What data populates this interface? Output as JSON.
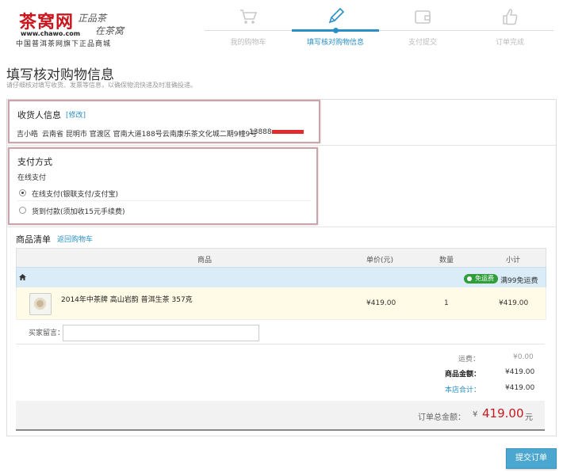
{
  "logo": {
    "brand": "茶窝网",
    "slogan_line1": "正品茶",
    "slogan_line2": "在茶窝",
    "site": "www.chawo.com",
    "tagline": "中国普洱茶网旗下正品商城"
  },
  "steps": [
    {
      "label": "我的购物车",
      "icon": "cart-icon",
      "active": false
    },
    {
      "label": "填写核对购物信息",
      "icon": "pencil-icon",
      "active": true
    },
    {
      "label": "支付提交",
      "icon": "wallet-icon",
      "active": false
    },
    {
      "label": "订单完成",
      "icon": "thumbs-up-icon",
      "active": false
    }
  ],
  "page": {
    "title": "填写核对购物信息",
    "subtitle": "请仔细核对填写收货、发票等信息，以确保物流快递及时准确投递。"
  },
  "receiver": {
    "title": "收货人信息",
    "edit_link": "[修改]",
    "name": "吉小皓",
    "address": "云南省 昆明市 官渡区 官南大道188号云南康乐茶文化城二期9幢9号",
    "phone": "13888"
  },
  "payment": {
    "title": "支付方式",
    "group_label": "在线支付",
    "options": [
      {
        "label": "在线支付(银联支付/支付宝)",
        "selected": true
      },
      {
        "label": "货到付款(须加收15元手续费)",
        "selected": false
      }
    ]
  },
  "goods": {
    "title": "商品清单",
    "back_link": "返回购物车",
    "headers": {
      "product": "商品",
      "price": "单价(元)",
      "qty": "数量",
      "subtotal": "小计"
    },
    "shop_icon": "home-icon",
    "free_badge": "免运费",
    "free_rule": "满99免运费",
    "items": [
      {
        "name": "2014年中茶牌 高山岩韵 普洱生茶 357克",
        "price": "¥419.00",
        "qty": "1",
        "subtotal": "¥419.00"
      }
    ],
    "remark_label": "买家留言：",
    "remark_value": ""
  },
  "summary": {
    "shipping_label": "运费：",
    "shipping_value": "¥0.00",
    "goods_amount_label": "商品金额：",
    "goods_amount_value": "¥419.00",
    "shop_total_label": "本店合计：",
    "shop_total_value": "¥419.00",
    "order_total_label": "订单总金额：",
    "order_total_currency": "¥",
    "order_total_value": "419.00",
    "order_total_unit": "元"
  },
  "submit_label": "提交订单",
  "colors": {
    "accent": "#2a8fc4",
    "price_red": "#c8171e",
    "free_green": "#2e9d3a"
  }
}
